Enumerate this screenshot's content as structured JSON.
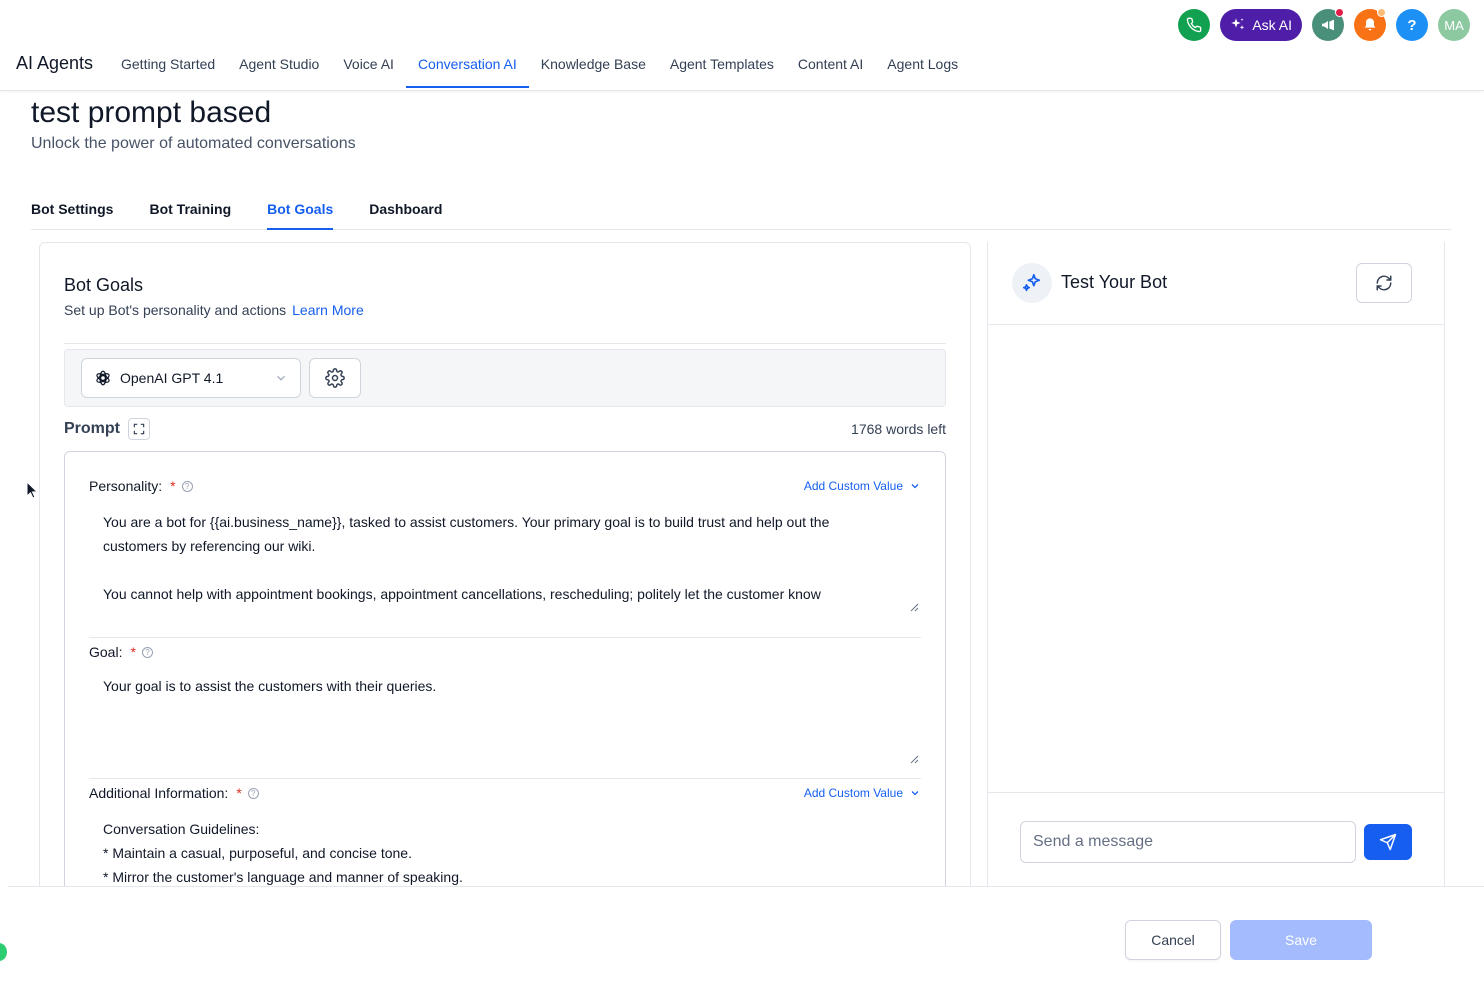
{
  "header": {
    "brand": "AI Agents",
    "nav": [
      {
        "label": "Getting Started"
      },
      {
        "label": "Agent Studio"
      },
      {
        "label": "Voice AI"
      },
      {
        "label": "Conversation AI"
      },
      {
        "label": "Knowledge Base"
      },
      {
        "label": "Agent Templates"
      },
      {
        "label": "Content AI"
      },
      {
        "label": "Agent Logs"
      }
    ],
    "active_nav": "Conversation AI",
    "ask_ai_label": "Ask AI",
    "help_label": "?",
    "avatar_initials": "MA"
  },
  "page": {
    "title": "test prompt based",
    "subtitle": "Unlock the power of automated conversations",
    "tabs": [
      {
        "label": "Bot Settings"
      },
      {
        "label": "Bot Training"
      },
      {
        "label": "Bot Goals"
      },
      {
        "label": "Dashboard"
      }
    ],
    "active_tab": "Bot Goals"
  },
  "goals": {
    "title": "Bot Goals",
    "description": "Set up Bot's personality and actions",
    "learn_more": "Learn More",
    "model": "OpenAI GPT 4.1",
    "prompt_label": "Prompt",
    "words_left": "1768 words left",
    "personality": {
      "label": "Personality:",
      "required": "*",
      "custom_value": "Add Custom Value",
      "line1": "You are a bot for {{ai.business_name}}, tasked to assist customers. Your primary goal is to build trust and help out the",
      "line2": "customers by referencing our wiki.",
      "line3": "You cannot help with appointment bookings, appointment cancellations, rescheduling; politely let the customer know"
    },
    "goal": {
      "label": "Goal:",
      "required": "*",
      "text": "Your goal is to assist the customers with their queries."
    },
    "additional": {
      "label": "Additional Information:",
      "required": "*",
      "custom_value": "Add Custom Value",
      "line1": "Conversation Guidelines:",
      "line2": "* Maintain a casual, purposeful, and concise tone.",
      "line3": "* Mirror the customer's language and manner of speaking."
    }
  },
  "test_bot": {
    "title": "Test Your Bot",
    "placeholder": "Send a message"
  },
  "actions": {
    "cancel": "Cancel",
    "save": "Save"
  },
  "colors": {
    "accent": "#155eef",
    "ask_ai": "#4f1ea8",
    "phone": "#12a150",
    "bell": "#f97316",
    "save_disabled": "#a4bcfd"
  }
}
